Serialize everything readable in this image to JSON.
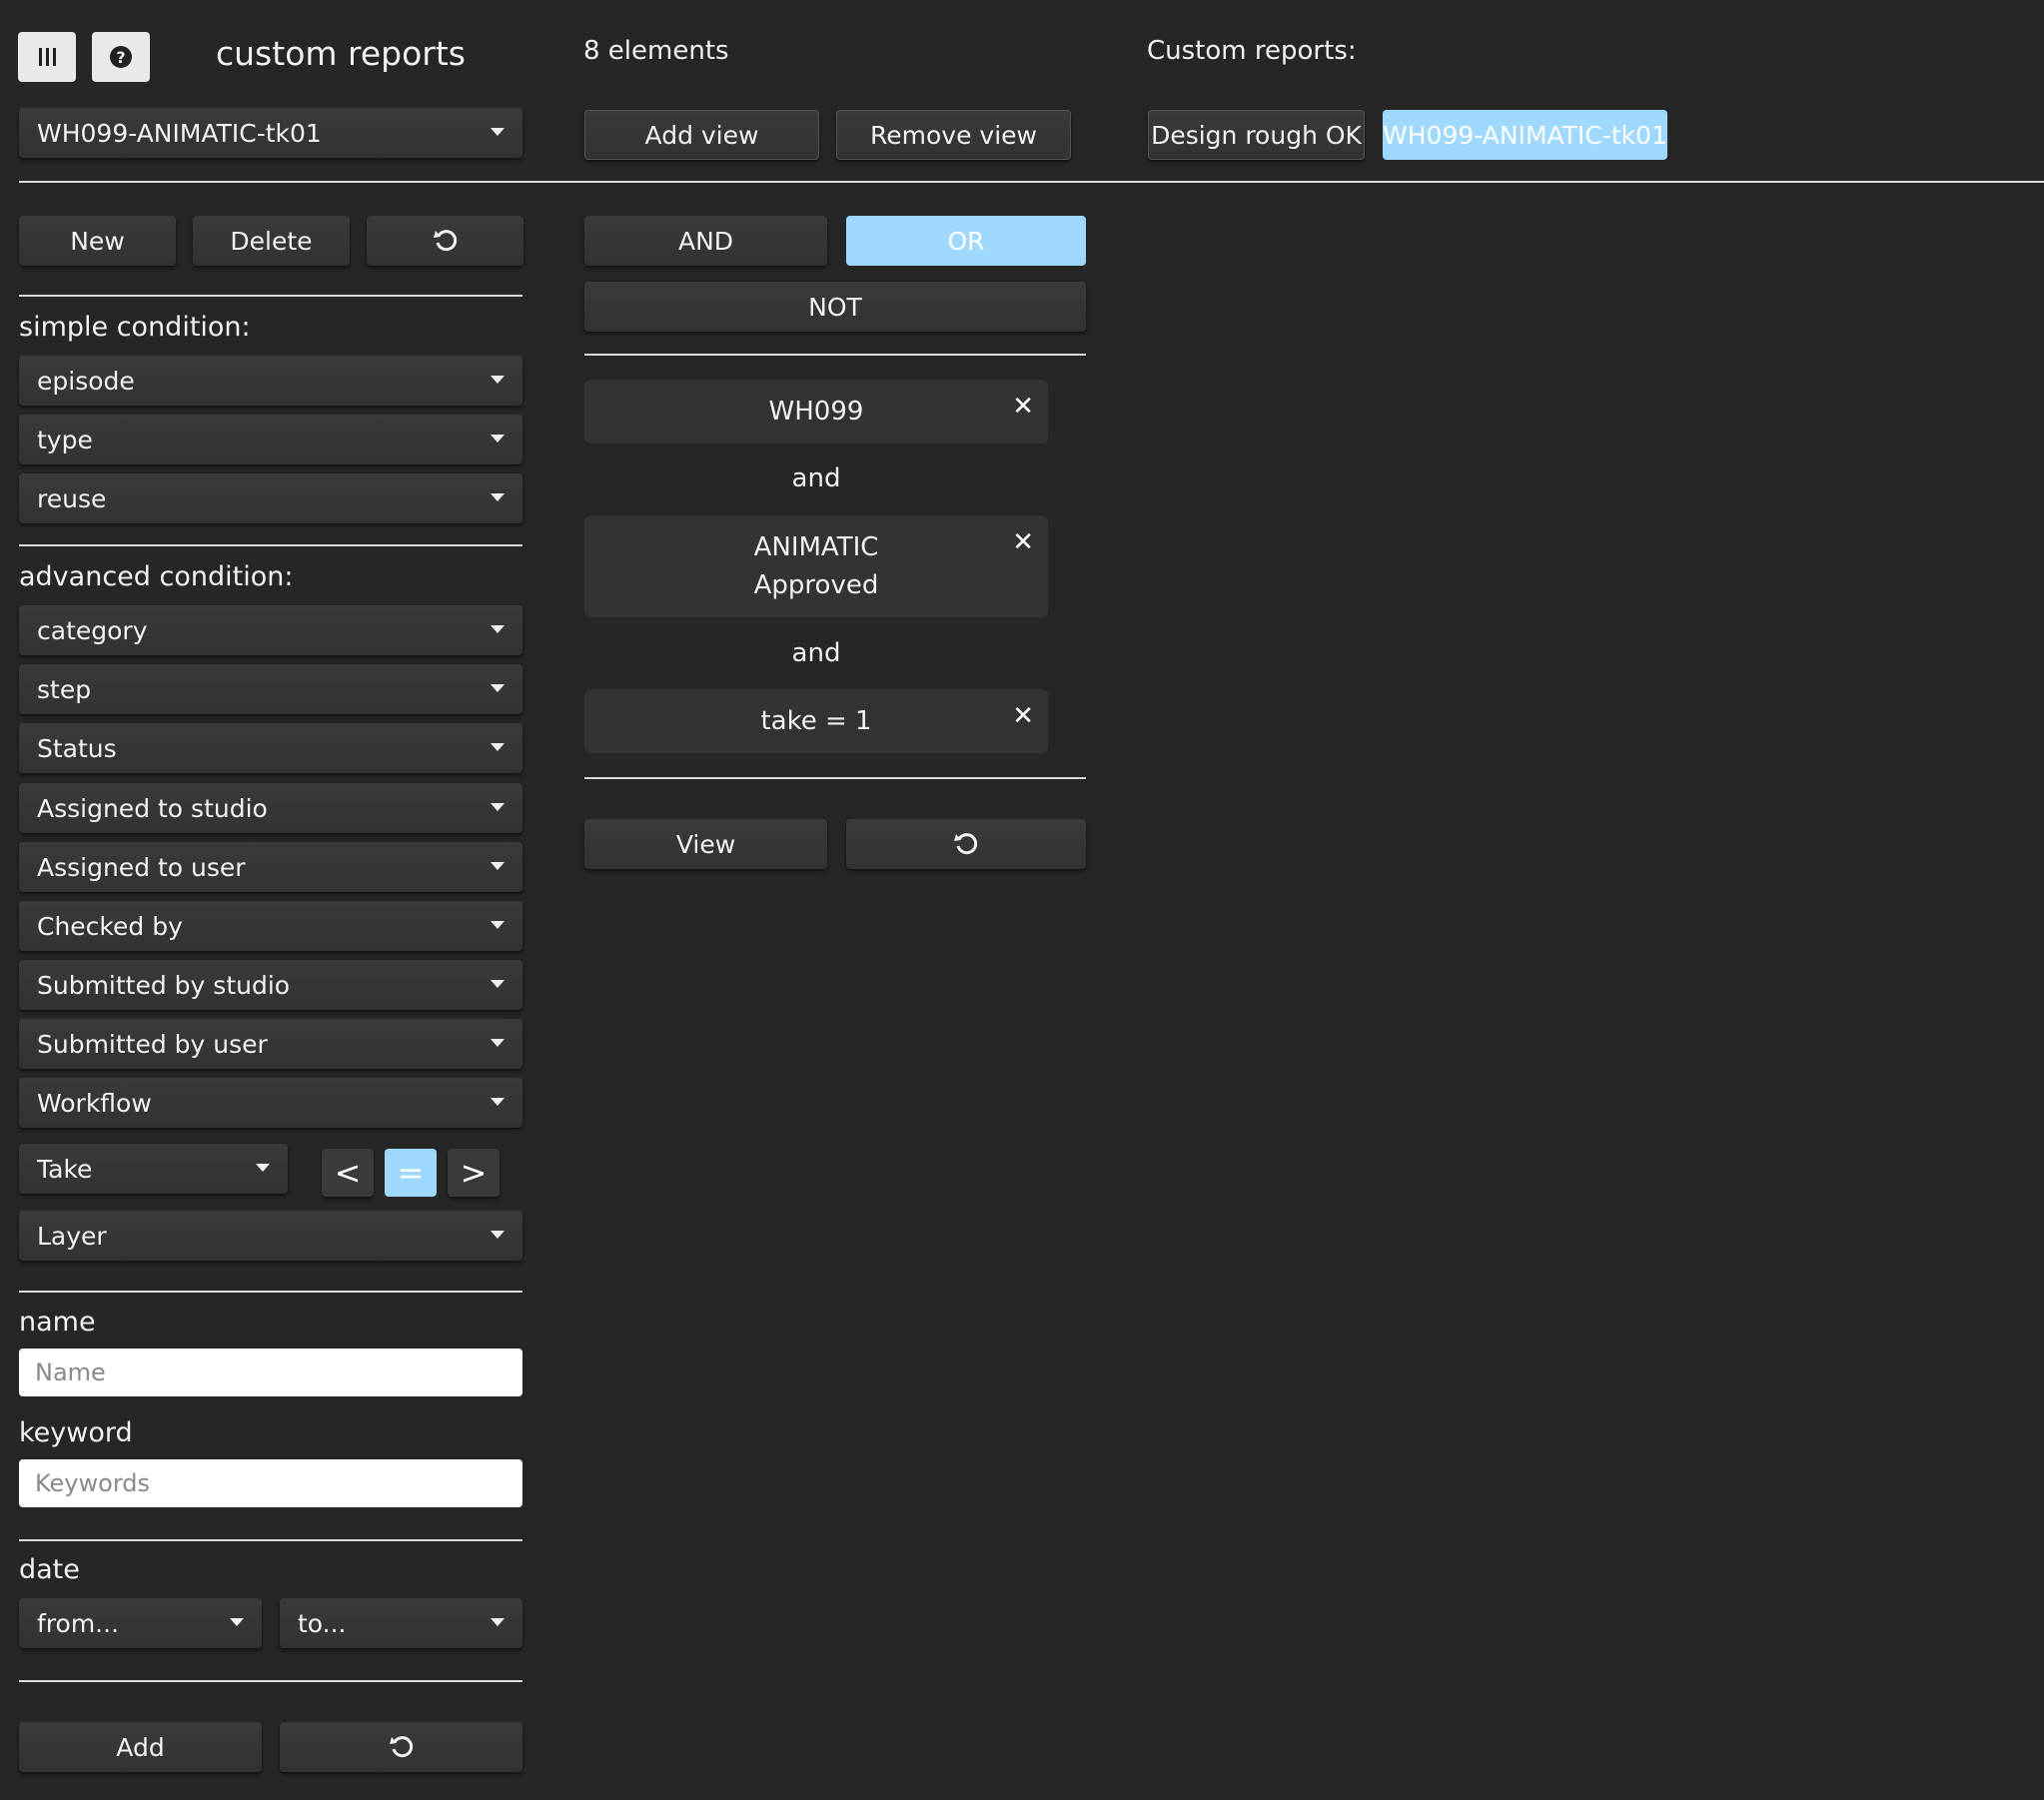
{
  "header": {
    "menu_icon": "menu-icon",
    "help_icon": "help-icon",
    "title": "custom reports",
    "element_count": "8 elements",
    "custom_reports_label": "Custom reports:"
  },
  "report_select": {
    "value": "WH099-ANIMATIC-tk01"
  },
  "view_buttons": {
    "add": "Add view",
    "remove": "Remove view"
  },
  "custom_reports": [
    {
      "label": "Design rough OK",
      "active": false
    },
    {
      "label": "WH099-ANIMATIC-tk01",
      "active": true
    }
  ],
  "actions": {
    "new": "New",
    "delete": "Delete",
    "reset_icon": "undo-icon"
  },
  "logic": {
    "and": "AND",
    "or": "OR",
    "not": "NOT",
    "active": "OR"
  },
  "simple": {
    "heading": "simple condition:",
    "dropdowns": [
      "episode",
      "type",
      "reuse"
    ]
  },
  "advanced": {
    "heading": "advanced condition:",
    "dropdowns": [
      "category",
      "step",
      "Status",
      "Assigned to studio",
      "Assigned to user",
      "Checked by",
      "Submitted by studio",
      "Submitted by user",
      "Workflow"
    ],
    "take": "Take",
    "compare": {
      "lt": "<",
      "eq": "=",
      "gt": ">",
      "active": "="
    },
    "layer": "Layer"
  },
  "name": {
    "heading": "name",
    "placeholder": "Name"
  },
  "keyword": {
    "heading": "keyword",
    "placeholder": "Keywords"
  },
  "date": {
    "heading": "date",
    "from": "from...",
    "to": "to..."
  },
  "bottom": {
    "add": "Add"
  },
  "conditions": [
    {
      "lines": [
        "WH099"
      ]
    },
    {
      "lines": [
        "ANIMATIC",
        "Approved"
      ]
    },
    {
      "lines": [
        "take = 1"
      ]
    }
  ],
  "connector": "and",
  "close_icon": "close-icon",
  "view_button": "View",
  "colors": {
    "background": "#262626",
    "button": "#363636",
    "accent": "#9fd9ff"
  }
}
